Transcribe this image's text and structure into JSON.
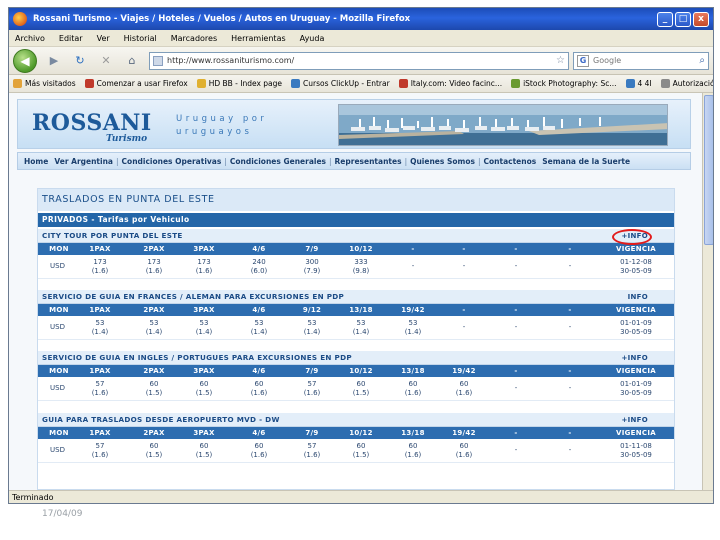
{
  "window": {
    "title": "Rossani Turismo - Viajes / Hoteles / Vuelos / Autos en Uruguay - Mozilla Firefox",
    "min_label": "_",
    "max_label": "□",
    "close_label": "x"
  },
  "menu": [
    "Archivo",
    "Editar",
    "Ver",
    "Historial",
    "Marcadores",
    "Herramientas",
    "Ayuda"
  ],
  "navbar": {
    "url": "http://www.rossaniturismo.com/",
    "search_engine": "G",
    "search_placeholder": "Google"
  },
  "bookmarks": [
    {
      "label": "Más visitados",
      "color": "#e2a33a"
    },
    {
      "label": "Comenzar a usar Firefox",
      "color": "#c0392b"
    },
    {
      "label": "HD BB - Index page",
      "color": "#e0b030"
    },
    {
      "label": "Cursos ClickUp - Entrar",
      "color": "#3a7ac0"
    },
    {
      "label": "Italy.com: Video facinc...",
      "color": "#c0392b"
    },
    {
      "label": "iStock Photography: Sc...",
      "color": "#6a9a30"
    },
    {
      "label": "4 4I",
      "color": "#3a7ac0"
    },
    {
      "label": "Autorización Req.",
      "color": "#8a8a8a"
    }
  ],
  "site": {
    "logo_main": "ROSSANI",
    "logo_sub": "Turismo",
    "slogan_line1": "Uruguay por",
    "slogan_line2": "uruguayos",
    "nav": [
      "Home",
      "Ver Argentina",
      "Condiciones Operativas",
      "Condiciones Generales",
      "Representantes",
      "Quienes Somos",
      "Contactenos",
      "Semana de la Suerte"
    ]
  },
  "page": {
    "title": "TRASLADOS EN PUNTA DEL ESTE",
    "section": "PRIVADOS - Tarifas por Vehiculo"
  },
  "services": [
    {
      "name": "CITY TOUR POR PUNTA DEL ESTE",
      "info": "+INFO",
      "headers": [
        "MON",
        "1PAX",
        "2PAX",
        "3PAX",
        "4/6",
        "7/9",
        "10/12",
        "-",
        "-",
        "-",
        "-",
        "VIGENCIA"
      ],
      "currency": "USD",
      "prices": [
        [
          "173",
          "(1.6)"
        ],
        [
          "173",
          "(1.6)"
        ],
        [
          "173",
          "(1.6)"
        ],
        [
          "240",
          "(6.0)"
        ],
        [
          "300",
          "(7.9)"
        ],
        [
          "333",
          "(9.8)"
        ],
        [
          "-",
          ""
        ],
        [
          "-",
          ""
        ],
        [
          "-",
          ""
        ],
        [
          "-",
          ""
        ]
      ],
      "validity": [
        "01-12-08",
        "30-05-09"
      ]
    },
    {
      "name": "SERVICIO DE GUIA EN FRANCES / ALEMAN PARA EXCURSIONES EN PDP",
      "info": "INFO",
      "headers": [
        "MON",
        "1PAX",
        "2PAX",
        "3PAX",
        "4/6",
        "9/12",
        "13/18",
        "19/42",
        "-",
        "-",
        "-",
        "VIGENCIA"
      ],
      "currency": "USD",
      "prices": [
        [
          "53",
          "(1.4)"
        ],
        [
          "53",
          "(1.4)"
        ],
        [
          "53",
          "(1.4)"
        ],
        [
          "53",
          "(1.4)"
        ],
        [
          "53",
          "(1.4)"
        ],
        [
          "53",
          "(1.4)"
        ],
        [
          "53",
          "(1.4)"
        ],
        [
          "-",
          ""
        ],
        [
          "-",
          ""
        ],
        [
          "-",
          ""
        ]
      ],
      "validity": [
        "01-01-09",
        "30-05-09"
      ]
    },
    {
      "name": "SERVICIO DE GUIA EN INGLES / PORTUGUES PARA EXCURSIONES EN PDP",
      "info": "+INFO",
      "headers": [
        "MON",
        "1PAX",
        "2PAX",
        "3PAX",
        "4/6",
        "7/9",
        "10/12",
        "13/18",
        "19/42",
        "-",
        "-",
        "VIGENCIA"
      ],
      "currency": "USD",
      "prices": [
        [
          "57",
          "(1.6)"
        ],
        [
          "60",
          "(1.5)"
        ],
        [
          "60",
          "(1.5)"
        ],
        [
          "60",
          "(1.6)"
        ],
        [
          "57",
          "(1.6)"
        ],
        [
          "60",
          "(1.5)"
        ],
        [
          "60",
          "(1.6)"
        ],
        [
          "60",
          "(1.6)"
        ],
        [
          "-",
          ""
        ],
        [
          "-",
          ""
        ]
      ],
      "validity": [
        "01-01-09",
        "30-05-09"
      ]
    },
    {
      "name": "GUIA PARA TRASLADOS DESDE AEROPUERTO MVD - DW",
      "info": "+INFO",
      "headers": [
        "MON",
        "1PAX",
        "2PAX",
        "3PAX",
        "4/6",
        "7/9",
        "10/12",
        "13/18",
        "19/42",
        "-",
        "-",
        "VIGENCIA"
      ],
      "currency": "USD",
      "prices": [
        [
          "57",
          "(1.6)"
        ],
        [
          "60",
          "(1.5)"
        ],
        [
          "60",
          "(1.5)"
        ],
        [
          "60",
          "(1.6)"
        ],
        [
          "57",
          "(1.6)"
        ],
        [
          "60",
          "(1.5)"
        ],
        [
          "60",
          "(1.6)"
        ],
        [
          "60",
          "(1.6)"
        ],
        [
          "-",
          ""
        ],
        [
          "-",
          ""
        ]
      ],
      "validity": [
        "01-11-08",
        "30-05-09"
      ]
    }
  ],
  "status": "Terminado",
  "slide_date": "17/04/09"
}
